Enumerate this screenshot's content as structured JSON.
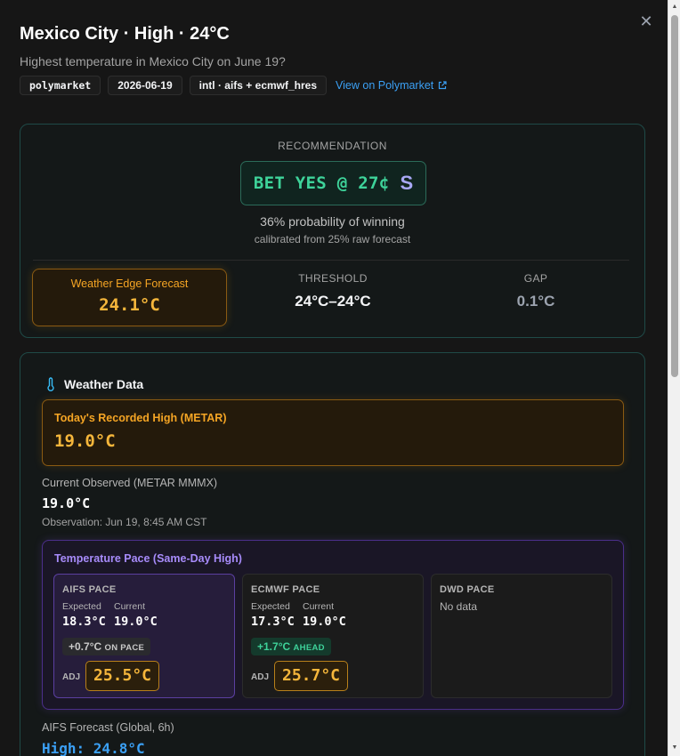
{
  "header": {
    "title": "Mexico City · High · 24°C",
    "subtitle": "Highest temperature in Mexico City on June 19?",
    "close_icon": "close-icon",
    "tags": [
      "polymarket",
      "2026-06-19",
      "intl · aifs + ecmwf_hres"
    ],
    "link_label": "View on Polymarket",
    "link_icon": "external-link-icon"
  },
  "recommendation": {
    "label": "RECOMMENDATION",
    "bet_label": "BET YES @ 27¢",
    "grade": "S",
    "probability_text": "36% probability of winning",
    "calibration_text": "calibrated from 25% raw forecast",
    "forecast_label": "Weather Edge Forecast",
    "forecast_value": "24.1°C",
    "threshold_label": "THRESHOLD",
    "threshold_value": "24°C–24°C",
    "gap_label": "GAP",
    "gap_value": "0.1°C"
  },
  "weather": {
    "title": "Weather Data",
    "icon": "thermometer-icon",
    "metar_high_label": "Today's Recorded High (METAR)",
    "metar_high_value": "19.0°C",
    "observed_label": "Current Observed (METAR MMMX)",
    "observed_value": "19.0°C",
    "observation_time": "Observation: Jun 19, 8:45 AM CST",
    "pace_title": "Temperature Pace (Same-Day High)",
    "pace": [
      {
        "name": "AIFS PACE",
        "expected_label": "Expected",
        "current_label": "Current",
        "expected": "18.3°C",
        "current": "19.0°C",
        "delta": "+0.7°C",
        "status": "ON PACE",
        "adj_label": "ADJ",
        "adj_value": "25.5°C"
      },
      {
        "name": "ECMWF PACE",
        "expected_label": "Expected",
        "current_label": "Current",
        "expected": "17.3°C",
        "current": "19.0°C",
        "delta": "+1.7°C",
        "status": "AHEAD",
        "adj_label": "ADJ",
        "adj_value": "25.7°C"
      },
      {
        "name": "DWD PACE",
        "no_data": "No data"
      }
    ],
    "aifs_label": "AIFS Forecast (Global, 6h)",
    "aifs_value": "High: 24.8°C"
  },
  "colors": {
    "accent_teal": "#1f4a47",
    "bet_green": "#3ed39a",
    "forecast_amber": "#f5b63b",
    "pace_purple": "#a78bfa",
    "link_blue": "#3ba0f5"
  }
}
